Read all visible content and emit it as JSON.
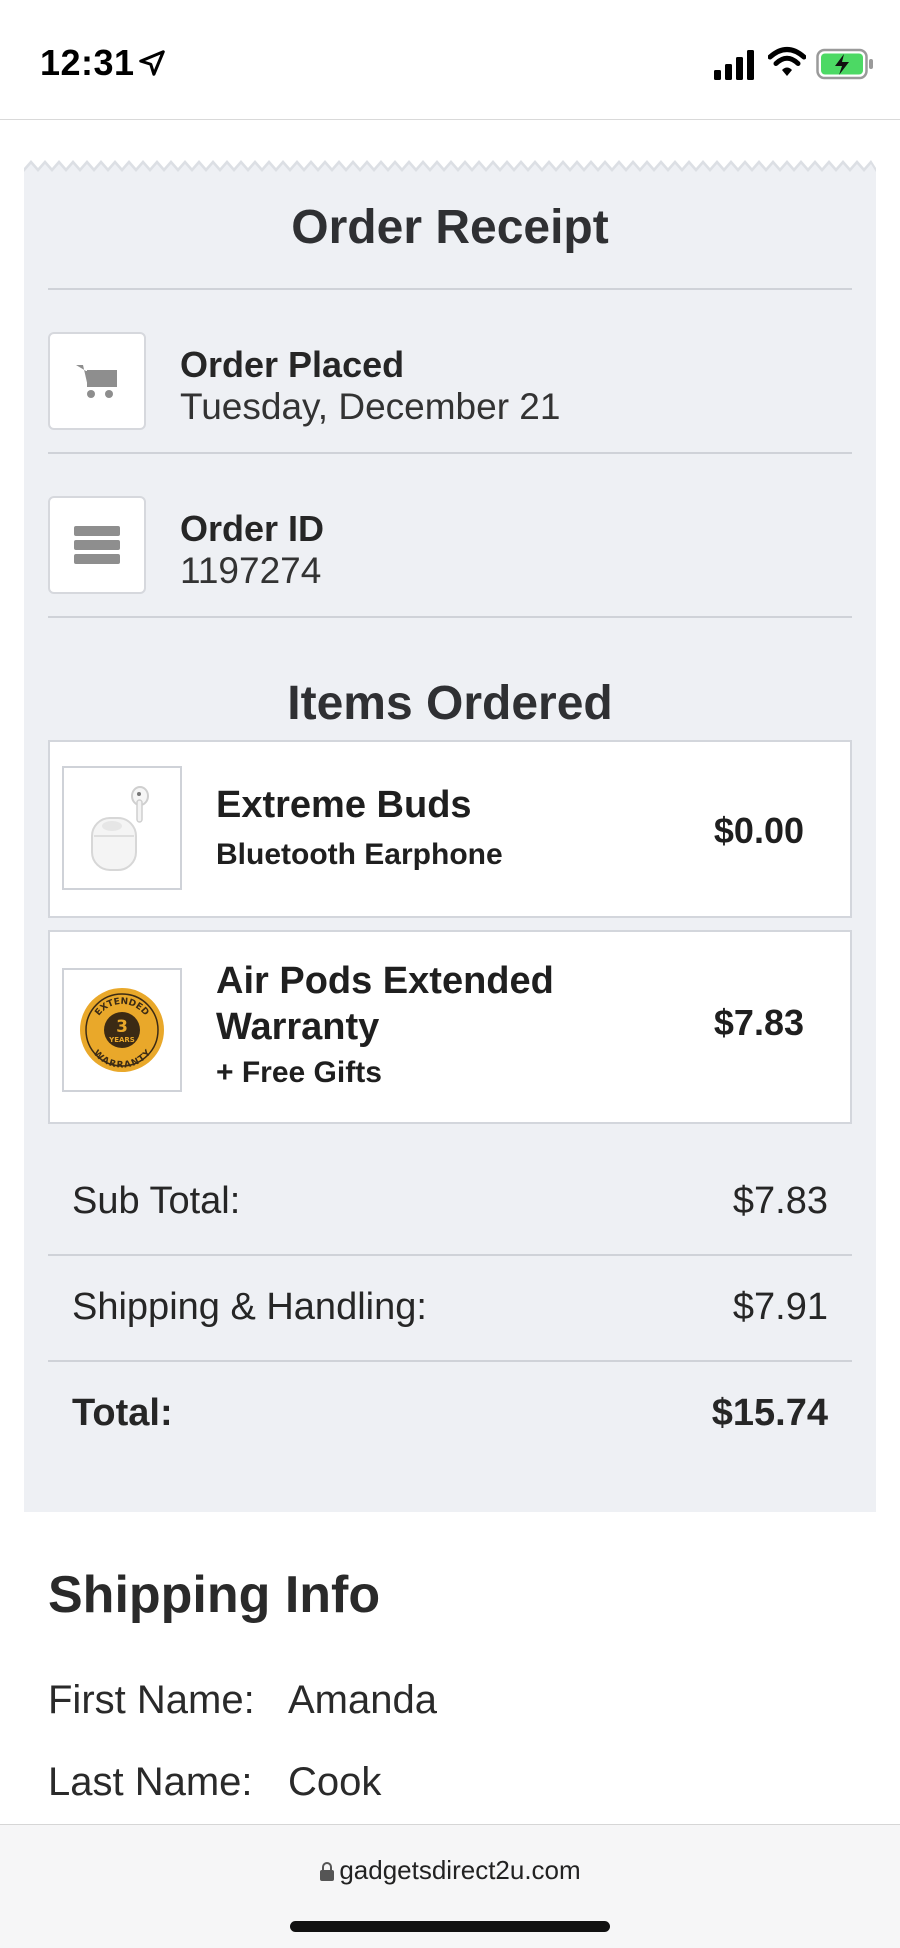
{
  "status_bar": {
    "time": "12:31",
    "icons": [
      "location-arrow-icon",
      "signal-icon",
      "wifi-icon",
      "battery-charging-icon"
    ]
  },
  "receipt": {
    "title": "Order Receipt",
    "order_placed": {
      "label": "Order Placed",
      "value": "Tuesday, December 21",
      "icon": "cart-icon"
    },
    "order_id": {
      "label": "Order ID",
      "value": "1197274",
      "icon": "list-icon"
    },
    "items_title": "Items Ordered",
    "items": [
      {
        "name": "Extreme Buds",
        "subtitle": "Bluetooth Earphone",
        "price": "$0.00",
        "image": "earbuds-image"
      },
      {
        "name": "Air Pods Extended Warranty",
        "subtitle": "+ Free Gifts",
        "price": "$7.83",
        "image": "warranty-badge-image",
        "badge_text": {
          "top": "EXTENDED",
          "number": "3",
          "unit": "YEARS",
          "bottom": "WARRANTY"
        }
      }
    ],
    "totals": [
      {
        "label": "Sub Total:",
        "value": "$7.83"
      },
      {
        "label": "Shipping & Handling:",
        "value": "$7.91"
      },
      {
        "label": "Total:",
        "value": "$15.74"
      }
    ]
  },
  "shipping": {
    "title": "Shipping Info",
    "first_name": {
      "label": "First Name:",
      "value": "Amanda"
    },
    "last_name": {
      "label": "Last Name:",
      "value": "Cook"
    }
  },
  "browser": {
    "url": "gadgetsdirect2u.com"
  },
  "colors": {
    "receipt_bg": "#eef0f4",
    "text": "#2b2b2b",
    "badge_gold": "#e9a82a"
  }
}
